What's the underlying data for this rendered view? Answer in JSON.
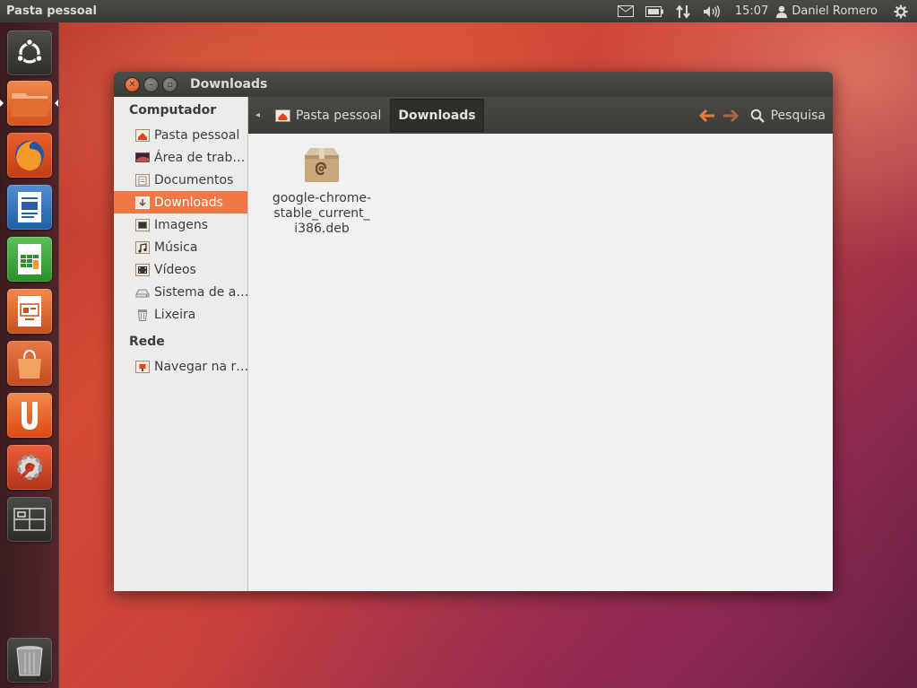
{
  "top_panel": {
    "app_title": "Pasta pessoal",
    "clock": "15:07",
    "user_name": "Daniel Romero",
    "icons": [
      "mail-icon",
      "battery-icon",
      "network-icon",
      "volume-icon",
      "user-icon",
      "session-gear-icon"
    ]
  },
  "launcher": {
    "items": [
      "dash-home",
      "files-home",
      "firefox",
      "libreoffice-writer",
      "libreoffice-calc",
      "libreoffice-impress",
      "ubuntu-software-center",
      "ubuntu-one",
      "system-settings",
      "workspace-switcher",
      "trash"
    ]
  },
  "window": {
    "title": "Downloads",
    "sidebar": {
      "computer_heading": "Computador",
      "items": [
        {
          "label": "Pasta pessoal",
          "icon": "home-folder-icon"
        },
        {
          "label": "Área de trab…",
          "icon": "desktop-icon"
        },
        {
          "label": "Documentos",
          "icon": "documents-folder-icon"
        },
        {
          "label": "Downloads",
          "icon": "downloads-folder-icon"
        },
        {
          "label": "Imagens",
          "icon": "pictures-folder-icon"
        },
        {
          "label": "Música",
          "icon": "music-folder-icon"
        },
        {
          "label": "Vídeos",
          "icon": "videos-folder-icon"
        },
        {
          "label": "Sistema de a…",
          "icon": "filesystem-icon"
        },
        {
          "label": "Lixeira",
          "icon": "trash-icon"
        }
      ],
      "network_heading": "Rede",
      "network_items": [
        {
          "label": "Navegar na r…",
          "icon": "network-folder-icon"
        }
      ]
    },
    "toolbar": {
      "breadcrumbs": [
        "Pasta pessoal",
        "Downloads"
      ],
      "search_label": "Pesquisa"
    },
    "files": [
      {
        "name_lines": [
          "google-chrome-",
          "stable_current_",
          "i386.deb"
        ],
        "icon": "deb-package-icon"
      }
    ]
  }
}
